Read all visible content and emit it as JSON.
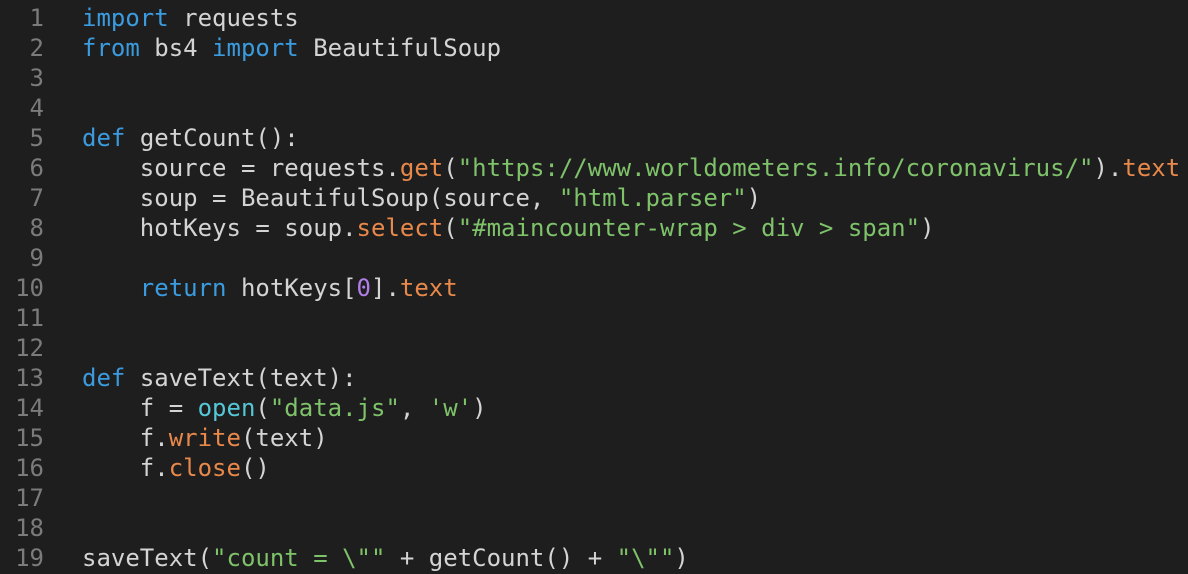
{
  "colors": {
    "background": "#1e1e1e",
    "line_number": "#7b7b7b",
    "plain": "#d4d4d4",
    "keyword": "#3b9bdf",
    "method": "#e8884a",
    "string": "#7ec26a",
    "number": "#b07ee8",
    "builtin": "#56c7d7"
  },
  "lines": [
    {
      "num": "1",
      "tokens": [
        {
          "t": "import",
          "c": "keyword"
        },
        {
          "t": " requests",
          "c": "plain"
        }
      ]
    },
    {
      "num": "2",
      "tokens": [
        {
          "t": "from",
          "c": "keyword"
        },
        {
          "t": " bs4 ",
          "c": "plain"
        },
        {
          "t": "import",
          "c": "keyword"
        },
        {
          "t": " BeautifulSoup",
          "c": "plain"
        }
      ]
    },
    {
      "num": "3",
      "tokens": []
    },
    {
      "num": "4",
      "tokens": []
    },
    {
      "num": "5",
      "tokens": [
        {
          "t": "def",
          "c": "keyword"
        },
        {
          "t": " ",
          "c": "plain"
        },
        {
          "t": "getCount",
          "c": "func"
        },
        {
          "t": "():",
          "c": "plain"
        }
      ]
    },
    {
      "num": "6",
      "tokens": [
        {
          "t": "    source = requests.",
          "c": "plain"
        },
        {
          "t": "get",
          "c": "method"
        },
        {
          "t": "(",
          "c": "plain"
        },
        {
          "t": "\"https://www.worldometers.info/coronavirus/\"",
          "c": "string"
        },
        {
          "t": ").",
          "c": "plain"
        },
        {
          "t": "text",
          "c": "method"
        }
      ]
    },
    {
      "num": "7",
      "tokens": [
        {
          "t": "    soup = BeautifulSoup(source, ",
          "c": "plain"
        },
        {
          "t": "\"html.parser\"",
          "c": "string"
        },
        {
          "t": ")",
          "c": "plain"
        }
      ]
    },
    {
      "num": "8",
      "tokens": [
        {
          "t": "    hotKeys = soup.",
          "c": "plain"
        },
        {
          "t": "select",
          "c": "method"
        },
        {
          "t": "(",
          "c": "plain"
        },
        {
          "t": "\"#maincounter-wrap > div > span\"",
          "c": "string"
        },
        {
          "t": ")",
          "c": "plain"
        }
      ]
    },
    {
      "num": "9",
      "tokens": []
    },
    {
      "num": "10",
      "tokens": [
        {
          "t": "    ",
          "c": "plain"
        },
        {
          "t": "return",
          "c": "keyword"
        },
        {
          "t": " hotKeys[",
          "c": "plain"
        },
        {
          "t": "0",
          "c": "number"
        },
        {
          "t": "].",
          "c": "plain"
        },
        {
          "t": "text",
          "c": "method"
        }
      ]
    },
    {
      "num": "11",
      "tokens": []
    },
    {
      "num": "12",
      "tokens": []
    },
    {
      "num": "13",
      "tokens": [
        {
          "t": "def",
          "c": "keyword"
        },
        {
          "t": " ",
          "c": "plain"
        },
        {
          "t": "saveText",
          "c": "func"
        },
        {
          "t": "(text):",
          "c": "plain"
        }
      ]
    },
    {
      "num": "14",
      "tokens": [
        {
          "t": "    f = ",
          "c": "plain"
        },
        {
          "t": "open",
          "c": "builtin"
        },
        {
          "t": "(",
          "c": "plain"
        },
        {
          "t": "\"data.js\"",
          "c": "string"
        },
        {
          "t": ", ",
          "c": "plain"
        },
        {
          "t": "'w'",
          "c": "string"
        },
        {
          "t": ")",
          "c": "plain"
        }
      ]
    },
    {
      "num": "15",
      "tokens": [
        {
          "t": "    f.",
          "c": "plain"
        },
        {
          "t": "write",
          "c": "method"
        },
        {
          "t": "(text)",
          "c": "plain"
        }
      ]
    },
    {
      "num": "16",
      "tokens": [
        {
          "t": "    f.",
          "c": "plain"
        },
        {
          "t": "close",
          "c": "method"
        },
        {
          "t": "()",
          "c": "plain"
        }
      ]
    },
    {
      "num": "17",
      "tokens": []
    },
    {
      "num": "18",
      "tokens": []
    },
    {
      "num": "19",
      "tokens": [
        {
          "t": "saveText(",
          "c": "plain"
        },
        {
          "t": "\"count = \\\"\"",
          "c": "string"
        },
        {
          "t": " + getCount() + ",
          "c": "plain"
        },
        {
          "t": "\"\\\"\"",
          "c": "string"
        },
        {
          "t": ")",
          "c": "plain"
        }
      ]
    }
  ]
}
